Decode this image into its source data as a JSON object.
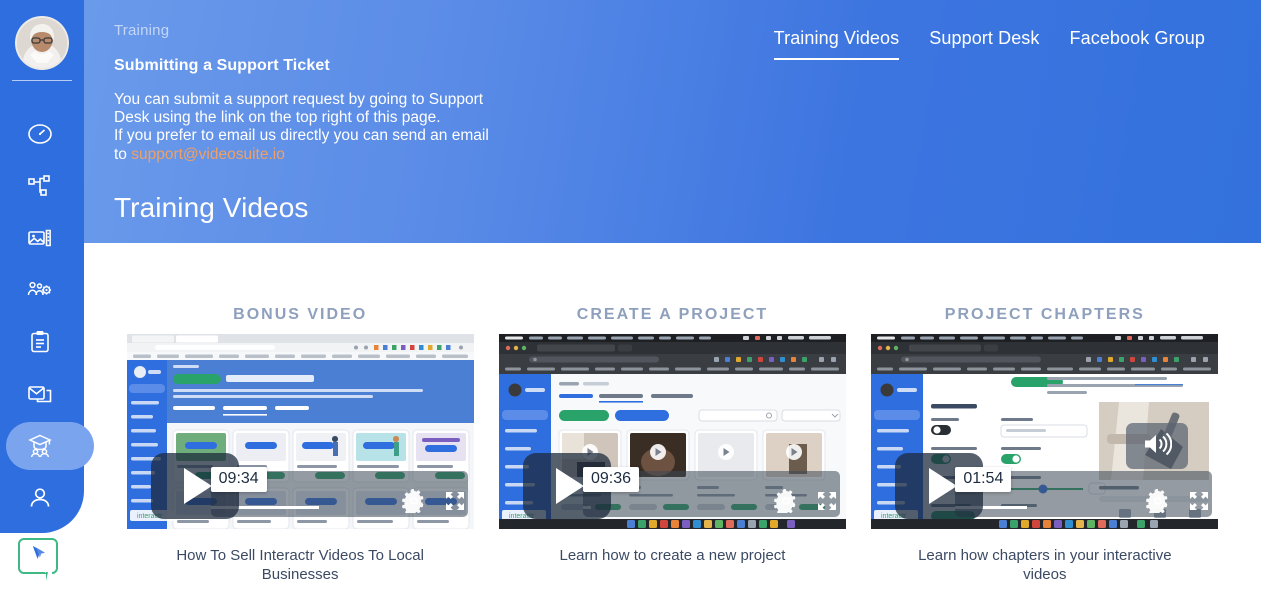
{
  "sidebar": {
    "avatar_name": "user-avatar",
    "items": [
      {
        "icon": "dashboard-gauge-icon",
        "name": "sidebar-item-dashboard",
        "active": false
      },
      {
        "icon": "workflow-branch-icon",
        "name": "sidebar-item-projects",
        "active": false
      },
      {
        "icon": "media-library-icon",
        "name": "sidebar-item-media-library",
        "active": false
      },
      {
        "icon": "agency-settings-icon",
        "name": "sidebar-item-agency",
        "active": false
      },
      {
        "icon": "clipboard-icon",
        "name": "sidebar-item-surveys",
        "active": false
      },
      {
        "icon": "inbox-mail-icon",
        "name": "sidebar-item-inbox",
        "active": false
      },
      {
        "icon": "graduation-cap-icon",
        "name": "sidebar-item-training",
        "active": true
      },
      {
        "icon": "person-icon",
        "name": "sidebar-item-account",
        "active": false
      }
    ],
    "help_bubble_icon": "cursor-chat-icon"
  },
  "banner": {
    "breadcrumb": "Training",
    "title": "Submitting a Support Ticket",
    "body_line1": "You can submit a support request by going to Support",
    "body_line2": "Desk using the link on the top right of this page.",
    "body_line3": "If you prefer to email us directly you can send an email",
    "body_line4_prefix": "to ",
    "support_email": "support@videosuite.io",
    "section_heading": "Training Videos",
    "tabs": [
      {
        "label": "Training Videos",
        "active": true
      },
      {
        "label": "Support Desk",
        "active": false
      },
      {
        "label": "Facebook Group",
        "active": false
      }
    ]
  },
  "videos": [
    {
      "heading": "Bonus Video",
      "caption": "How To Sell Interactr Videos To Local Businesses",
      "duration": "09:34",
      "has_volume_overlay": false,
      "progress_pct": 42,
      "play_icon": "play-icon",
      "settings_icon": "gear-icon",
      "fullscreen_icon": "fullscreen-icon"
    },
    {
      "heading": "Create A Project",
      "caption": "Learn how to create a new project",
      "duration": "09:36",
      "has_volume_overlay": false,
      "progress_pct": 3,
      "play_icon": "play-icon",
      "settings_icon": "gear-icon",
      "fullscreen_icon": "fullscreen-icon"
    },
    {
      "heading": "Project Chapters",
      "caption": "Learn how chapters in your interactive videos",
      "duration": "01:54",
      "has_volume_overlay": true,
      "volume_icon": "volume-up-icon",
      "progress_pct": 28,
      "play_icon": "play-icon",
      "settings_icon": "gear-icon",
      "fullscreen_icon": "fullscreen-icon"
    }
  ],
  "colors": {
    "sidebar_blue": "#2f6ede",
    "sidebar_active": "#7ba4ee",
    "banner_gradient_from": "#6a9aea",
    "banner_gradient_to": "#3371dd",
    "link_orange": "#f0a063",
    "heading_gray": "#8ea0bd",
    "caption_navy": "#3b4a63",
    "help_green": "#3fb984"
  }
}
